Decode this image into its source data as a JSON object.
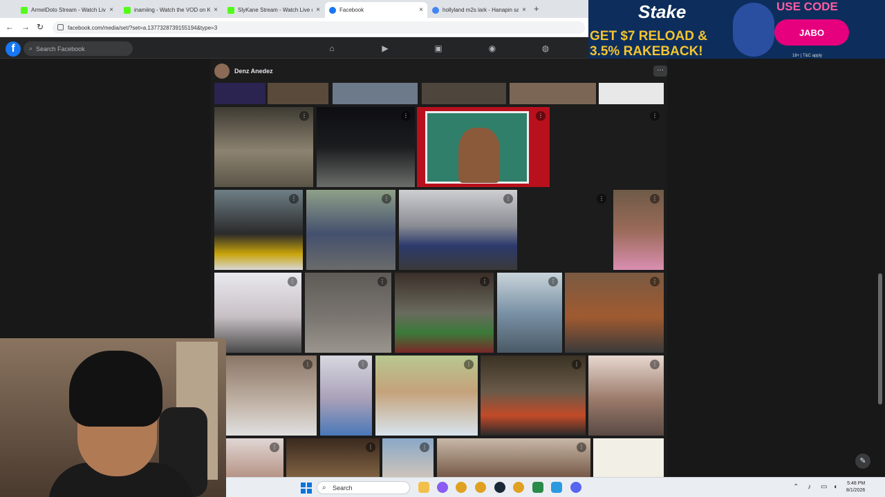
{
  "browser": {
    "tabs": [
      {
        "title": "ArmelDoto Stream - Watch Live",
        "favicon_color": "#53fc18",
        "active": false
      },
      {
        "title": "inamiing - Watch the VOD on K",
        "favicon_color": "#53fc18",
        "active": false
      },
      {
        "title": "SlyKane Stream - Watch Live or",
        "favicon_color": "#53fc18",
        "active": false
      },
      {
        "title": "Facebook",
        "favicon_color": "#1877f2",
        "active": true
      },
      {
        "title": "hollyland m2s lark - Hanapin sa",
        "favicon_color": "#4285f4",
        "active": false
      }
    ],
    "new_tab_glyph": "+",
    "close_glyph": "×",
    "url": "facebook.com/media/set/?set=a.1377328739155194&type=3"
  },
  "ad": {
    "brand": "Stake",
    "offer": "GET $7 RELOAD & 3.5% RAKEBACK!",
    "use_code": "USE CODE",
    "code": "JABO",
    "terms": "18+ | T&C apply"
  },
  "facebook": {
    "logo": "f",
    "search_placeholder": "Search Facebook",
    "nav_icons": [
      "home-icon",
      "video-icon",
      "marketplace-icon",
      "groups-icon",
      "gaming-icon"
    ]
  },
  "album": {
    "owner": "Denz Anedez",
    "more_glyph": "···",
    "photo_menu_glyph": "⋮"
  },
  "taskbar": {
    "search_placeholder": "Search",
    "time": "5:48 PM",
    "date": "8/1/2026"
  },
  "colors": {
    "fb_blue": "#1877f2",
    "fb_dark": "#242526",
    "ad_bg": "#0d2e5c",
    "ad_accent": "#e6007e"
  }
}
